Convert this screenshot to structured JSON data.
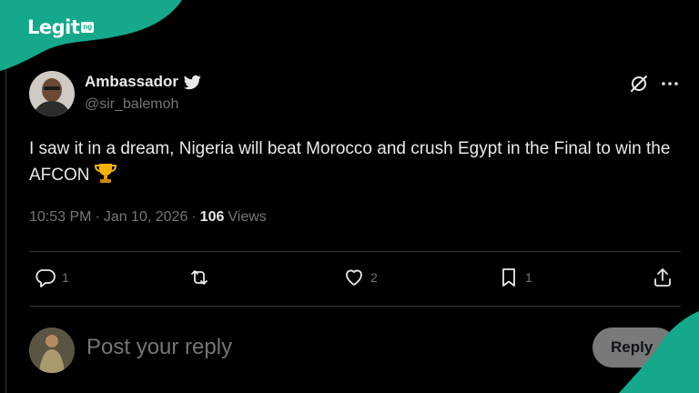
{
  "brand": {
    "logo_text": "Legit",
    "logo_suffix": "ng",
    "accent_color": "#14a98b"
  },
  "author": {
    "display_name": "Ambassador",
    "handle": "@sir_balemoh",
    "verified_icon": "twitter-bird-icon"
  },
  "header_icons": [
    "grok-icon",
    "more-options-icon"
  ],
  "tweet": {
    "text": "I saw it in a dream, Nigeria will beat Morocco and crush Egypt in the Final to win the AFCON",
    "emoji": "trophy-emoji",
    "time": "10:53 PM",
    "separator": "·",
    "date": "Jan 10, 2026",
    "views_count": "106",
    "views_label": "Views"
  },
  "actions": {
    "reply_count": "1",
    "repost_count": "",
    "like_count": "2",
    "bookmark_count": "1",
    "share_icon": "share-icon"
  },
  "composer": {
    "placeholder": "Post your reply",
    "button_label": "Reply"
  },
  "colors": {
    "background": "#000000",
    "primary_text": "#e7e9ea",
    "secondary_text": "#71767b",
    "divider": "#2f3336",
    "button_bg": "#787a7a"
  }
}
